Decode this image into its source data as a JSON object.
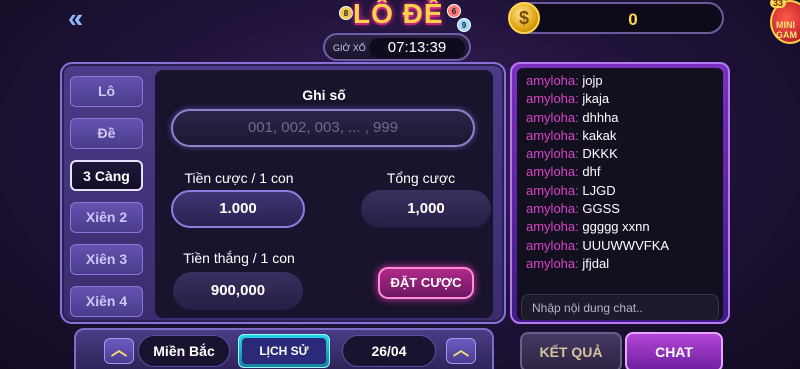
{
  "header": {
    "back_icon": "double-chevron-left-icon",
    "logo_text": "LÔ ĐỀ",
    "balls": [
      "8",
      "6",
      "9"
    ],
    "draw_label": "GIỜ XỔ",
    "draw_time": "07:13:39",
    "coin_icon_glyph": "$",
    "balance": "0",
    "mini_game_badge": "33",
    "mini_game_label": "MINI GAM"
  },
  "bet_types": [
    "Lô",
    "Đề",
    "3 Càng",
    "Xiên 2",
    "Xiên 3",
    "Xiên 4"
  ],
  "active_bet_type": "3 Càng",
  "form": {
    "numbers_label": "Ghi số",
    "numbers_placeholder": "001, 002, 003, ... , 999",
    "stake_label": "Tiền cược / 1 con",
    "stake_value": "1.000",
    "total_label": "Tổng cược",
    "total_value": "1,000",
    "win_label": "Tiền thắng / 1 con",
    "win_value": "900,000",
    "place_bet_label": "ĐẶT CƯỢC"
  },
  "chat": {
    "messages": [
      {
        "user": "amyloha:",
        "text": "jojp"
      },
      {
        "user": "amyloha:",
        "text": "jkaja"
      },
      {
        "user": "amyloha:",
        "text": "dhhha"
      },
      {
        "user": "amyloha:",
        "text": "kakak"
      },
      {
        "user": "amyloha:",
        "text": "DKKK"
      },
      {
        "user": "amyloha:",
        "text": "dhf"
      },
      {
        "user": "amyloha:",
        "text": "LJGD"
      },
      {
        "user": "amyloha:",
        "text": "GGSS"
      },
      {
        "user": "amyloha:",
        "text": "ggggg xxnn"
      },
      {
        "user": "amyloha:",
        "text": "UUUWWVFKA"
      },
      {
        "user": "amyloha:",
        "text": "jfjdal"
      }
    ],
    "input_placeholder": "Nhập nội dung chat.."
  },
  "bottom": {
    "up_icon": "chevron-up-icon",
    "region": "Miền Bắc",
    "history_label": "LỊCH SỬ CƯỢC",
    "date": "26/04",
    "results_label": "KẾT QUẢ",
    "chat_label": "CHAT"
  },
  "colors": {
    "accent_pink": "#d843c9",
    "gold": "#ffd84d",
    "panel": "#4d3a88"
  }
}
